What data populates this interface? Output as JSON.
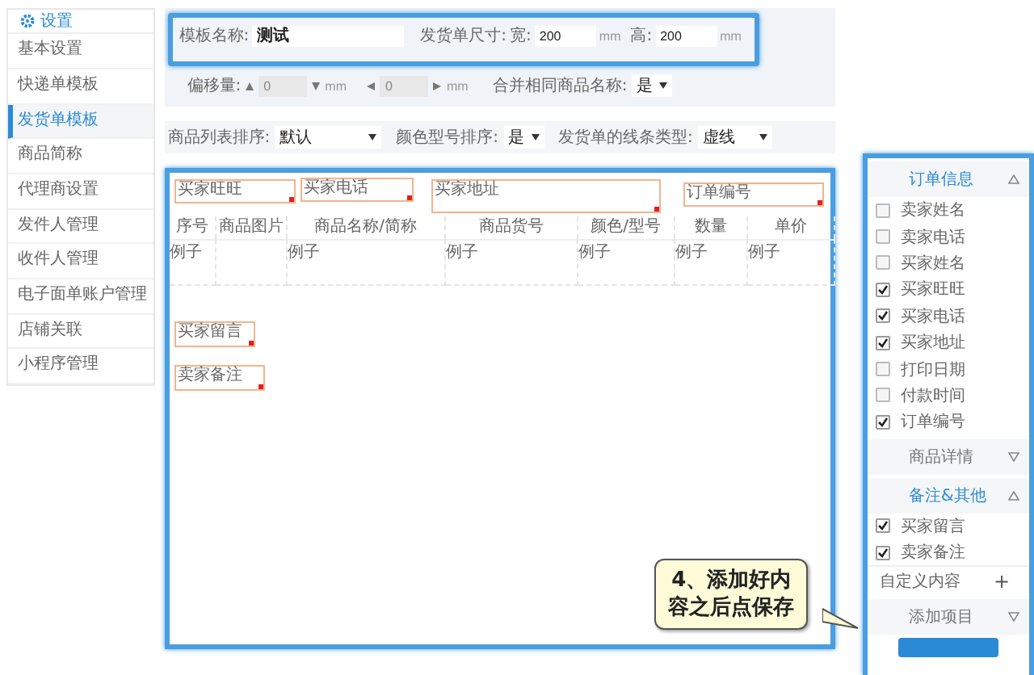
{
  "sidebar": {
    "title": "设置",
    "items": [
      {
        "label": "基本设置",
        "selected": false
      },
      {
        "label": "快递单模板",
        "selected": false
      },
      {
        "label": "发货单模板",
        "selected": true
      },
      {
        "label": "商品简称",
        "selected": false
      },
      {
        "label": "代理商设置",
        "selected": false
      },
      {
        "label": "发件人管理",
        "selected": false
      },
      {
        "label": "收件人管理",
        "selected": false
      },
      {
        "label": "电子面单账户管理",
        "selected": false
      },
      {
        "label": "店铺关联",
        "selected": false
      },
      {
        "label": "小程序管理",
        "selected": false
      }
    ]
  },
  "template_form": {
    "name_label": "模板名称:",
    "name_value": "测试",
    "size_label": "发货单尺寸:",
    "width_label": "宽:",
    "width_value": "200",
    "width_unit": "mm",
    "height_label": "高:",
    "height_value": "200",
    "height_unit": "mm",
    "offset_label": "偏移量:",
    "offset_y_value": "0",
    "offset_y_unit": "mm",
    "offset_x_value": "0",
    "offset_x_unit": "mm",
    "merge_label": "合并相同商品名称:",
    "merge_value": "是"
  },
  "sort_options": [
    {
      "label": "商品列表排序:",
      "value": "默认"
    },
    {
      "label": "颜色型号排序:",
      "value": "是"
    },
    {
      "label": "发货单的线条类型:",
      "value": "虚线"
    }
  ],
  "canvas": {
    "fields": [
      {
        "label": "买家旺旺"
      },
      {
        "label": "买家电话"
      },
      {
        "label": "买家地址"
      },
      {
        "label": "订单编号"
      },
      {
        "label": "买家留言"
      },
      {
        "label": "卖家备注"
      }
    ],
    "table": {
      "columns": [
        {
          "label": "序号",
          "example": "例子"
        },
        {
          "label": "商品图片"
        },
        {
          "label": "商品名称/简称",
          "example": "例子"
        },
        {
          "label": "商品货号",
          "example": "例子"
        },
        {
          "label": "颜色/型号",
          "example": "例子"
        },
        {
          "label": "数量",
          "example": "例子"
        },
        {
          "label": "单价",
          "example": "例子"
        }
      ]
    }
  },
  "panel": {
    "groups": [
      {
        "title": "订单信息",
        "expanded": true,
        "items": [
          {
            "label": "卖家姓名",
            "checked": false
          },
          {
            "label": "卖家电话",
            "checked": false
          },
          {
            "label": "买家姓名",
            "checked": false
          },
          {
            "label": "买家旺旺",
            "checked": true
          },
          {
            "label": "买家电话",
            "checked": true
          },
          {
            "label": "买家地址",
            "checked": true
          },
          {
            "label": "打印日期",
            "checked": false
          },
          {
            "label": "付款时间",
            "checked": false
          },
          {
            "label": "订单编号",
            "checked": true
          }
        ]
      },
      {
        "title": "商品详情",
        "expanded": false
      },
      {
        "title": "备注&其他",
        "expanded": true,
        "items": [
          {
            "label": "买家留言",
            "checked": true
          },
          {
            "label": "卖家备注",
            "checked": true
          }
        ],
        "custom": "自定义内容",
        "custom_icon": "+"
      },
      {
        "title": "添加项目",
        "expanded": false
      }
    ]
  },
  "callout": {
    "text": "4、添加好内容之后点保存"
  }
}
